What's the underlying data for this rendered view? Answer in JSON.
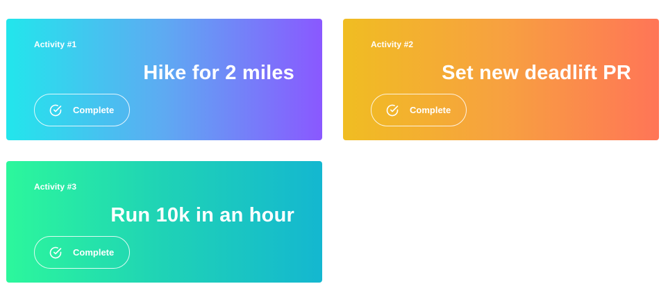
{
  "activities": [
    {
      "label": "Activity #1",
      "title": "Hike for 2 miles",
      "button_label": "Complete"
    },
    {
      "label": "Activity #2",
      "title": "Set new deadlift PR",
      "button_label": "Complete"
    },
    {
      "label": "Activity #3",
      "title": "Run 10k in an hour",
      "button_label": "Complete"
    }
  ],
  "icons": {
    "complete": "check-circle-icon"
  },
  "colors": {
    "card_1_gradient": [
      "#22e6ec",
      "#8a58ff"
    ],
    "card_2_gradient": [
      "#f0bd22",
      "#ff7557"
    ],
    "card_3_gradient": [
      "#2cf79c",
      "#14b7d0"
    ],
    "text": "#ffffff"
  }
}
